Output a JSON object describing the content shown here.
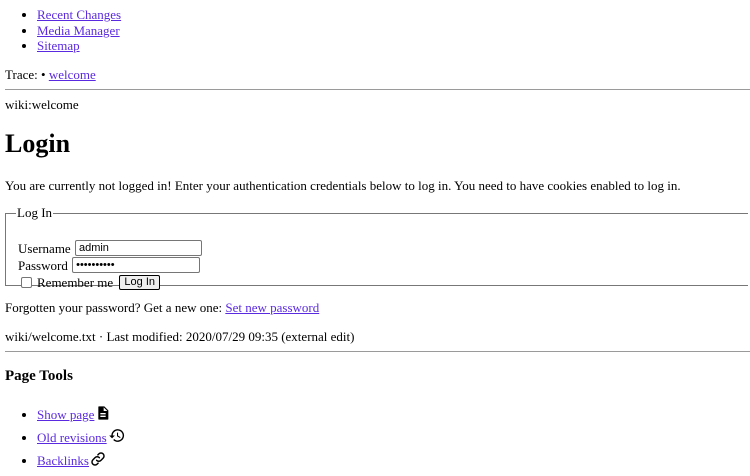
{
  "nav": {
    "items": [
      {
        "label": "Recent Changes"
      },
      {
        "label": "Media Manager"
      },
      {
        "label": "Sitemap"
      }
    ]
  },
  "breadcrumbs": {
    "prefix": "Trace:",
    "separator": "•",
    "items": [
      "welcome"
    ]
  },
  "page_id": "wiki:welcome",
  "page": {
    "title": "Login",
    "intro": "You are currently not logged in! Enter your authentication credentials below to log in. You need to have cookies enabled to log in."
  },
  "login_form": {
    "legend": "Log In",
    "username_label": "Username",
    "username_value": "admin",
    "password_label": "Password",
    "password_value": "••••••••••",
    "remember_label": "Remember me",
    "remember_checked": false,
    "submit_label": "Log In"
  },
  "forgot": {
    "text": "Forgotten your password? Get a new one:",
    "link_label": "Set new password"
  },
  "docinfo": "wiki/welcome.txt · Last modified: 2020/07/29 09:35 (external edit)",
  "page_tools": {
    "title": "Page Tools",
    "items": [
      {
        "label": "Show page",
        "icon": "document-icon"
      },
      {
        "label": "Old revisions",
        "icon": "history-icon"
      },
      {
        "label": "Backlinks",
        "icon": "link-icon"
      }
    ]
  }
}
